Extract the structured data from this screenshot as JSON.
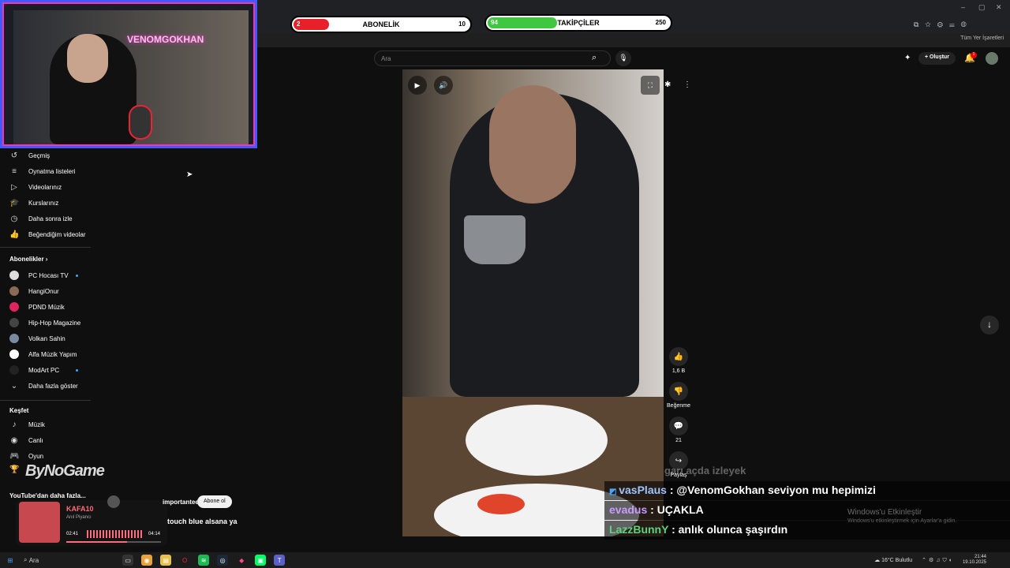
{
  "stream": {
    "subs_bar": {
      "count": "2",
      "label": "ABONELİK",
      "goal": "10",
      "color": "#e8202a",
      "progress": 0.2
    },
    "follow_bar": {
      "count": "94",
      "label": "TAKİPÇİLER",
      "goal": "250",
      "color": "#3fc73f",
      "progress": 0.376
    },
    "webcam_neon": "VENOMGOKHAN",
    "logo_text": "ByNoGame"
  },
  "browser": {
    "bookmarks_label": "Tüm Yer İşaretleri",
    "window_controls": [
      "–",
      "▢",
      "✕"
    ]
  },
  "youtube": {
    "search_placeholder": "Ara",
    "create_label": "Oluştur",
    "notification_count": "1",
    "nav_items": [
      {
        "label": "Geçmiş",
        "icon": "history-icon"
      },
      {
        "label": "Oynatma listeleri",
        "icon": "playlist-icon"
      },
      {
        "label": "Videolarınız",
        "icon": "video-icon"
      },
      {
        "label": "Kurslarınız",
        "icon": "course-icon"
      },
      {
        "label": "Daha sonra izle",
        "icon": "clock-icon"
      },
      {
        "label": "Beğendiğim videolar",
        "icon": "like-icon"
      }
    ],
    "subscriptions_title": "Abonelikler",
    "subscriptions": [
      {
        "label": "PC Hocası TV",
        "color": "#dddddd",
        "live_dot": true
      },
      {
        "label": "HangiOnur",
        "color": "#8a6a55",
        "live_dot": false
      },
      {
        "label": "PDND Müzik",
        "color": "#e0245e",
        "live_dot": false
      },
      {
        "label": "Hip-Hop Magazine",
        "color": "#444444",
        "live_dot": false
      },
      {
        "label": "Volkan Sahin",
        "color": "#7a8aa0",
        "live_dot": false
      },
      {
        "label": "Alfa Müzik Yapım",
        "color": "#ffffff",
        "live_dot": false
      },
      {
        "label": "ModArt PC",
        "color": "#222222",
        "live_dot": true
      }
    ],
    "show_more": "Daha fazla göster",
    "explore_title": "Keşfet",
    "explore_items": [
      {
        "label": "Müzik",
        "icon": "music-icon"
      },
      {
        "label": "Canlı",
        "icon": "live-icon"
      },
      {
        "label": "Oyun",
        "icon": "game-icon"
      }
    ],
    "more_from_youtube": "YouTube'dan daha fazla...",
    "short_actions": {
      "like_count": "1,6 B",
      "dislike_label": "Beğenme",
      "comment_count": "21",
      "share_label": "Paylaş"
    },
    "channel_name": "importantee",
    "subscribe_label": "Abone ol",
    "caption": "touch blue alsana ya"
  },
  "music_player": {
    "title": "KAFA10",
    "subtitle": "Anıl Piyancı",
    "elapsed": "02:41",
    "duration": "04:14",
    "progress": 0.64
  },
  "chat": {
    "faded_line": "garı açda izleyek",
    "messages": [
      {
        "user": "vasPlaus",
        "text": ": @VenomGokhan seviyon mu hepimizi",
        "color": "#9fc4ff"
      },
      {
        "user": "evadus",
        "text": ": UÇAKLA",
        "color": "#c89bff"
      },
      {
        "user": "LazzBunnY",
        "text": ": anlık olunca şaşırdın",
        "color": "#5fd17e"
      }
    ]
  },
  "windows": {
    "watermark_title": "Windows'u Etkinleştir",
    "watermark_sub": "Windows'u etkinleştirmek için Ayarlar'a gidin.",
    "search_label": "Ara",
    "weather": "16°C Bulutlu",
    "time": "21:44",
    "date": "19.10.2025"
  }
}
